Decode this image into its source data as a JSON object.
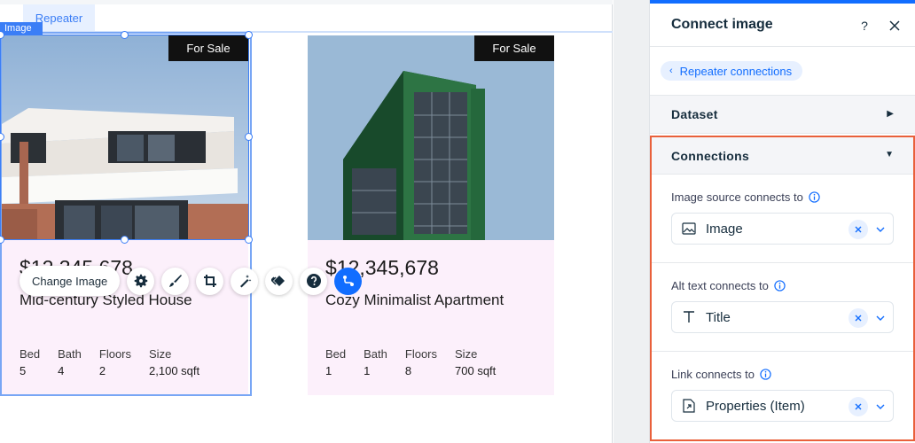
{
  "canvas": {
    "repeater_tab": "Repeater",
    "image_tag": "Image",
    "cards": [
      {
        "badge": "For Sale",
        "price": "$12,345,678",
        "title": "Mid-century Styled House",
        "stats": [
          {
            "label": "Bed",
            "value": "5"
          },
          {
            "label": "Bath",
            "value": "4"
          },
          {
            "label": "Floors",
            "value": "2"
          },
          {
            "label": "Size",
            "value": "2,100 sqft"
          }
        ]
      },
      {
        "badge": "For Sale",
        "price": "$12,345,678",
        "title": "Cozy Minimalist Apartment",
        "stats": [
          {
            "label": "Bed",
            "value": "1"
          },
          {
            "label": "Bath",
            "value": "1"
          },
          {
            "label": "Floors",
            "value": "8"
          },
          {
            "label": "Size",
            "value": "700 sqft"
          }
        ]
      }
    ],
    "toolbar": {
      "change_image": "Change Image",
      "icons": [
        "gear-icon",
        "brush-icon",
        "crop-icon",
        "magic-wand-icon",
        "animation-icon",
        "help-icon",
        "connect-data-icon"
      ]
    }
  },
  "panel": {
    "title": "Connect image",
    "help_icon": "question-icon",
    "close_icon": "close-icon",
    "back_label": "Repeater connections",
    "dataset_label": "Dataset",
    "connections_label": "Connections",
    "fields": [
      {
        "label": "Image source connects to",
        "value": "Image",
        "icon": "image-icon"
      },
      {
        "label": "Alt text connects to",
        "value": "Title",
        "icon": "text-icon"
      },
      {
        "label": "Link connects to",
        "value": "Properties (Item)",
        "icon": "page-link-icon"
      }
    ],
    "accent": "#116dff",
    "highlight": "#e9603b"
  }
}
